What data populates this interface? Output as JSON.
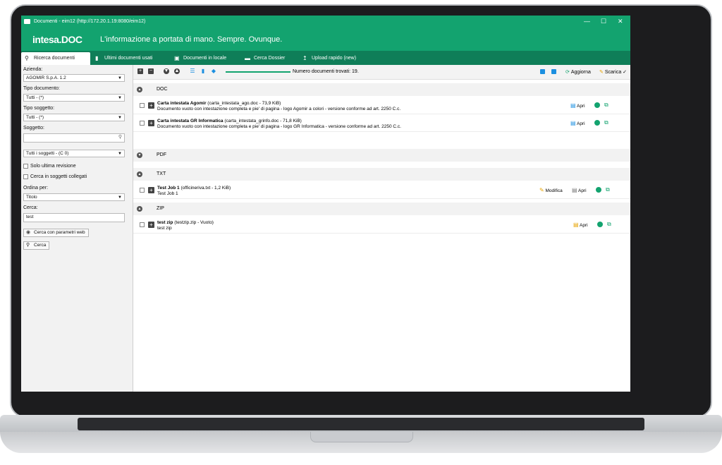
{
  "window": {
    "title": "Documenti - eim12 (http://172.20.1.19:8080/eim12)",
    "controls": [
      "—",
      "☐",
      "✕"
    ]
  },
  "brand": {
    "logo": "intesa.DOC",
    "slogan": "L'informazione a portata di mano. Sempre. Ovunque."
  },
  "tabs": [
    {
      "label": "Ricerca documenti",
      "icon": "search-icon"
    },
    {
      "label": "Ultimi documenti usati",
      "icon": "document-icon"
    },
    {
      "label": "Documenti in locale",
      "icon": "lock-icon"
    },
    {
      "label": "Cerca Dossier",
      "icon": "folder-icon"
    },
    {
      "label": "Upload rapido (new)",
      "icon": "upload-icon"
    }
  ],
  "filters": {
    "azienda_label": "Azienda:",
    "azienda_value": "AGOMIR S.p.A. 1.2",
    "tipo_documento_label": "Tipo documento:",
    "tipo_documento_value": "Tutti - (*)",
    "tipo_soggetto_label": "Tipo soggetto:",
    "tipo_soggetto_value": "Tutti - (*)",
    "soggetto_label": "Soggetto:",
    "soggetto_value": "",
    "soggetti_scope": "Tutti i soggetti - (C 0)",
    "solo_ultima_revisione": "Solo ultima revisione",
    "cerca_collegati": "Cerca in soggetti collegati",
    "ordina_label": "Ordina per:",
    "ordina_value": "Titolo",
    "cerca_label": "Cerca:",
    "cerca_value": "test",
    "web_search_button": "Cerca con parametri web",
    "search_button": "Cerca"
  },
  "toolbar": {
    "count_label": "Numero documenti trovati: 19.",
    "refresh_label": "Aggiorna",
    "download_label": "Scarica",
    "download_check": "✓"
  },
  "groups": [
    {
      "name": "DOC",
      "rows": [
        {
          "title": "Carta intestata Agomir",
          "meta": "(carta_intestata_ago.doc - 73,9 KiB)",
          "desc": "Documento vuoto con intestazione completa e pie' di pagina - logo Agomir a colori - versione conforme ad art. 2250 C.c.",
          "open": "Apri"
        },
        {
          "title": "Carta intestata GR Informatica",
          "meta": "(carta_intestata_grinfo.doc - 71,8 KiB)",
          "desc": "Documento vuoto con intestazione completa e pie' di pagina - logo GR Informatica - versione conforme ad art. 2250 C.c.",
          "open": "Apri"
        }
      ]
    },
    {
      "name": "PDF",
      "rows": []
    },
    {
      "name": "TXT",
      "rows": [
        {
          "title": "Test Job 1",
          "meta": "(officineriva.txt - 1,2 KiB)",
          "desc": "Test Job 1",
          "edit": "Modifica",
          "open": "Apri"
        }
      ]
    },
    {
      "name": "ZIP",
      "rows": [
        {
          "title": "test zip",
          "meta": "(testzip.zip - Vuoto)",
          "desc": "test zip",
          "open": "Apri"
        }
      ]
    }
  ],
  "colors": {
    "brand_green": "#13a36f",
    "accent_blue": "#1b8fe0"
  }
}
